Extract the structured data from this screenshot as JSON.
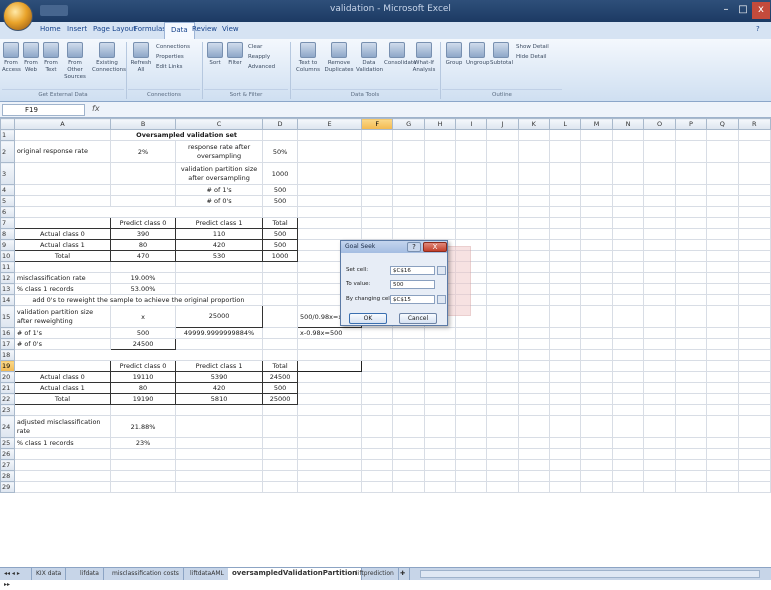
{
  "window": {
    "title": "validation - Microsoft Excel"
  },
  "ribbon_tabs": [
    "Home",
    "Insert",
    "Page Layout",
    "Formulas",
    "Data",
    "Review",
    "View"
  ],
  "ribbon": {
    "get_external": {
      "buttons": [
        "From Access",
        "From Web",
        "From Text",
        "From Other Sources",
        "Existing Connections"
      ],
      "label": "Get External Data"
    },
    "connections": {
      "refresh": "Refresh All",
      "small": [
        "Connections",
        "Properties",
        "Edit Links"
      ],
      "label": "Connections"
    },
    "sort_filter": {
      "sort": "Sort",
      "filter": "Filter",
      "small": [
        "Clear",
        "Reapply",
        "Advanced"
      ],
      "label": "Sort & Filter"
    },
    "data_tools": {
      "buttons": [
        "Text to Columns",
        "Remove Duplicates",
        "Data Validation",
        "Consolidate",
        "What-If Analysis"
      ],
      "label": "Data Tools"
    },
    "outline": {
      "buttons": [
        "Group",
        "Ungroup",
        "Subtotal"
      ],
      "small": [
        "Show Detail",
        "Hide Detail"
      ],
      "label": "Outline"
    }
  },
  "formula_bar": {
    "cell_ref": "F19",
    "fx": "fx",
    "value": ""
  },
  "columns": [
    "A",
    "B",
    "C",
    "D",
    "E",
    "F",
    "G",
    "H",
    "I",
    "J",
    "K",
    "L",
    "M",
    "N",
    "O",
    "P",
    "Q",
    "R"
  ],
  "selected_column": "F",
  "selected_row": "19",
  "rows": [
    {
      "n": "1",
      "cells": [
        "",
        "Oversampled validation set",
        "",
        "",
        "",
        "",
        "",
        ""
      ]
    },
    {
      "n": "2",
      "cells": [
        "original response rate",
        "2%",
        "response rate after oversampling",
        "50%",
        "",
        "",
        "",
        ""
      ]
    },
    {
      "n": "3",
      "cells": [
        "",
        "",
        "validation partition size after oversampling",
        "1000",
        "",
        "",
        "",
        ""
      ]
    },
    {
      "n": "4",
      "cells": [
        "",
        "",
        "# of 1's",
        "500",
        "",
        "",
        "",
        ""
      ]
    },
    {
      "n": "5",
      "cells": [
        "",
        "",
        "# of 0's",
        "500",
        "",
        "",
        "",
        ""
      ]
    },
    {
      "n": "6",
      "cells": [
        "",
        "Validation classification matrix",
        "",
        "",
        "",
        "",
        "",
        ""
      ]
    },
    {
      "n": "7",
      "cells": [
        "",
        "Predict class 0",
        "Predict class 1",
        "Total",
        "",
        "",
        "",
        ""
      ]
    },
    {
      "n": "8",
      "cells": [
        "Actual class 0",
        "390",
        "110",
        "500",
        "",
        "",
        "",
        ""
      ]
    },
    {
      "n": "9",
      "cells": [
        "Actual class 1",
        "80",
        "420",
        "500",
        "",
        "",
        "",
        ""
      ]
    },
    {
      "n": "10",
      "cells": [
        "Total",
        "470",
        "530",
        "1000",
        "",
        "",
        "",
        ""
      ]
    },
    {
      "n": "11",
      "cells": [
        "",
        "",
        "",
        "",
        "",
        "",
        "",
        ""
      ]
    },
    {
      "n": "12",
      "cells": [
        "misclassification rate",
        "19.00%",
        "",
        "",
        "",
        "",
        "",
        ""
      ]
    },
    {
      "n": "13",
      "cells": [
        "% class 1 records",
        "53.00%",
        "",
        "",
        "",
        "",
        "",
        ""
      ]
    },
    {
      "n": "14",
      "cells": [
        "add 0's to reweight the sample to achieve the original proportion",
        "",
        "",
        "",
        "",
        "",
        "",
        ""
      ]
    },
    {
      "n": "15",
      "cells": [
        "validation partition size after reweighting",
        "x",
        "25000",
        "",
        "500/0.98x=x",
        "",
        "",
        ""
      ]
    },
    {
      "n": "16",
      "cells": [
        "# of 1's",
        "500",
        "49999.9999999884%",
        "",
        "x-0.98x=500",
        "",
        "",
        ""
      ]
    },
    {
      "n": "17",
      "cells": [
        "# of 0's",
        "24500",
        "",
        "",
        "",
        "",
        "",
        ""
      ]
    },
    {
      "n": "18",
      "cells": [
        "",
        "Validation classification matrix after reweighting",
        "",
        "",
        "",
        "",
        "",
        ""
      ]
    },
    {
      "n": "19",
      "cells": [
        "",
        "Predict class 0",
        "Predict class 1",
        "Total",
        "",
        "",
        "",
        ""
      ]
    },
    {
      "n": "20",
      "cells": [
        "Actual class 0",
        "19110",
        "5390",
        "24500",
        "",
        "",
        "",
        ""
      ]
    },
    {
      "n": "21",
      "cells": [
        "Actual class 1",
        "80",
        "420",
        "500",
        "",
        "",
        "",
        ""
      ]
    },
    {
      "n": "22",
      "cells": [
        "Total",
        "19190",
        "5810",
        "25000",
        "",
        "",
        "",
        ""
      ]
    },
    {
      "n": "23",
      "cells": [
        "",
        "",
        "",
        "",
        "",
        "",
        "",
        ""
      ]
    },
    {
      "n": "24",
      "cells": [
        "adjusted misclassification rate",
        "21.88%",
        "",
        "",
        "",
        "",
        "",
        ""
      ]
    },
    {
      "n": "25",
      "cells": [
        "% class 1 records",
        "23%",
        "",
        "",
        "",
        "",
        "",
        ""
      ]
    },
    {
      "n": "26",
      "cells": [
        "",
        "",
        "",
        "",
        "",
        "",
        "",
        ""
      ]
    },
    {
      "n": "27",
      "cells": [
        "",
        "",
        "",
        "",
        "",
        "",
        "",
        ""
      ]
    },
    {
      "n": "28",
      "cells": [
        "",
        "",
        "",
        "",
        "",
        "",
        "",
        ""
      ]
    },
    {
      "n": "29",
      "cells": [
        "",
        "",
        "",
        "",
        "",
        "",
        "",
        ""
      ]
    }
  ],
  "goal_seek": {
    "title": "Goal Seek",
    "set_cell_label": "Set cell:",
    "set_cell_value": "$C$16",
    "to_value_label": "To value:",
    "to_value_value": "500",
    "by_changing_label": "By changing cell:",
    "by_changing_value": "$C$15",
    "ok": "OK",
    "cancel": "Cancel",
    "help": "?",
    "close": "X"
  },
  "sheet_tabs": [
    "KIX data",
    "lifdata",
    "misclassification costs",
    "liftdataAML",
    "oversampledValidationPartition",
    "liftprediction"
  ],
  "active_sheet": "oversampledValidationPartition",
  "status": {
    "text": "Ready"
  }
}
